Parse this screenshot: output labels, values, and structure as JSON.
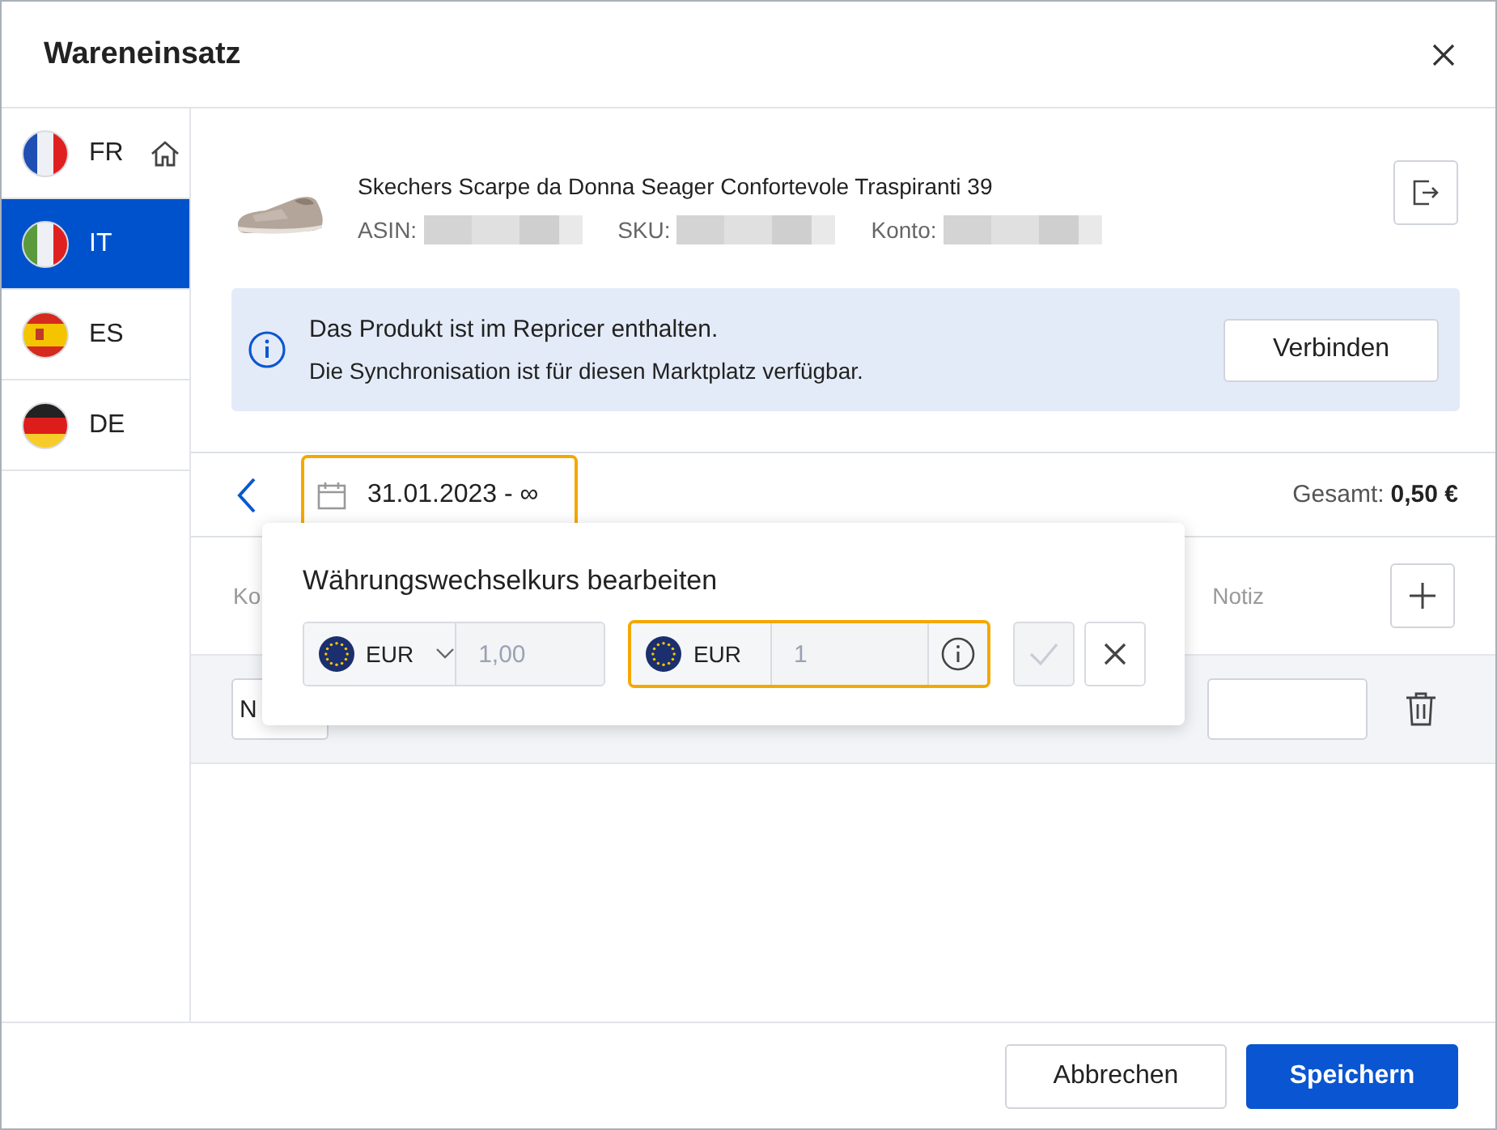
{
  "window": {
    "title": "Wareneinsatz"
  },
  "marketplaces": [
    {
      "code": "FR",
      "kind": "fr",
      "home": true,
      "selected": false
    },
    {
      "code": "IT",
      "kind": "it",
      "home": false,
      "selected": true
    },
    {
      "code": "ES",
      "kind": "es",
      "home": false,
      "selected": false
    },
    {
      "code": "DE",
      "kind": "de",
      "home": false,
      "selected": false
    }
  ],
  "product": {
    "title": "Skechers Scarpe da Donna Seager Confortevole Traspiranti 39",
    "fields": [
      {
        "label": "ASIN:"
      },
      {
        "label": "SKU:"
      },
      {
        "label": "Konto:"
      }
    ]
  },
  "notice": {
    "lines": [
      "Das Produkt ist im Repricer enthalten.",
      "Die Synchronisation ist für diesen Marktplatz verfügbar."
    ],
    "button": "Verbinden"
  },
  "date_range": {
    "value": "31.01.2023 - ∞",
    "focused": true
  },
  "total": {
    "label": "Gesamt:",
    "value": "0,50 €"
  },
  "table": {
    "columns": [
      "Ko",
      "Notiz"
    ],
    "rows": [
      {
        "cell_1": "N"
      }
    ]
  },
  "exchange_popup": {
    "title": "Währungswechselkurs bearbeiten",
    "from": {
      "currency": "EUR",
      "placeholder": "1,00",
      "focused": false
    },
    "to": {
      "currency": "EUR",
      "placeholder": "1",
      "focused": true
    },
    "confirm_disabled": true
  },
  "buttons": [
    {
      "label": "Abbrechen",
      "kind": "secondary"
    },
    {
      "label": "Speichern",
      "kind": "primary"
    }
  ]
}
